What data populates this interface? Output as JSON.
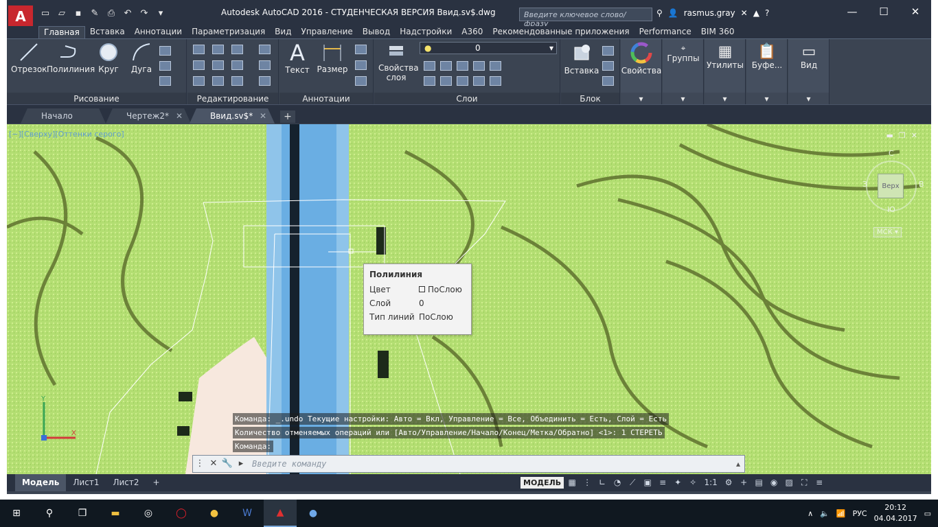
{
  "titlebar": {
    "app_letter": "A",
    "title": "Autodesk AutoCAD 2016 - СТУДЕНЧЕСКАЯ ВЕРСИЯ    Ввид.sv$.dwg",
    "search_placeholder": "Введите ключевое слово/фразу",
    "username": "rasmus.gray",
    "help": "?"
  },
  "ribbon_tabs": [
    "Главная",
    "Вставка",
    "Аннотации",
    "Параметризация",
    "Вид",
    "Управление",
    "Вывод",
    "Надстройки",
    "A360",
    "Рекомендованные приложения",
    "Performance",
    "BIM 360"
  ],
  "ribbon": {
    "draw": {
      "title": "Рисование",
      "items": [
        "Отрезок",
        "Полилиния",
        "Круг",
        "Дуга"
      ]
    },
    "modify": {
      "title": "Редактирование"
    },
    "annot": {
      "title": "Аннотации",
      "items": [
        "Текст",
        "Размер"
      ]
    },
    "layers": {
      "title": "Слои",
      "props": "Свойства слоя",
      "layer_value": "0"
    },
    "block": {
      "title": "Блок",
      "insert": "Вставка"
    },
    "props": "Свойства",
    "groups": "Группы",
    "utils": "Утилиты",
    "clipboard": "Буфе...",
    "view": "Вид"
  },
  "doc_tabs": [
    "Начало",
    "Чертеж2*",
    "Ввид.sv$*"
  ],
  "viewport": {
    "label": "[−][Сверху][Оттенки серого]",
    "cube_top": "Верх",
    "dir_n": "С",
    "dir_w": "З",
    "dir_e": "В",
    "dir_s": "Ю",
    "ucs_label": "МСК"
  },
  "tooltip": {
    "title": "Полилиния",
    "rows": [
      {
        "k": "Цвет",
        "v": "ПоСлою"
      },
      {
        "k": "Слой",
        "v": "0"
      },
      {
        "k": "Тип линий",
        "v": "ПоСлою"
      }
    ]
  },
  "command": {
    "history": [
      "Команда:  _.undo Текущие настройки: Авто = Вкл, Управление = Все, Объединить = Есть, Слой = Есть",
      "Количество отменяемых операций или [Авто/Управление/Начало/Конец/Метка/Обратно] <1>: 1 СТЕРЕТЬ",
      "Команда:"
    ],
    "placeholder": "Введите команду"
  },
  "status": {
    "layout_tabs": [
      "Модель",
      "Лист1",
      "Лист2"
    ],
    "model": "МОДЕЛЬ",
    "scale": "1:1"
  },
  "taskbar": {
    "lang": "РУС",
    "time": "20:12",
    "date": "04.04.2017"
  },
  "colors": {
    "autocad_red": "#c8272e",
    "ribbon_bg": "#3b4452",
    "titlebar_bg": "#2a3241",
    "map_green": "#b7e07a"
  }
}
